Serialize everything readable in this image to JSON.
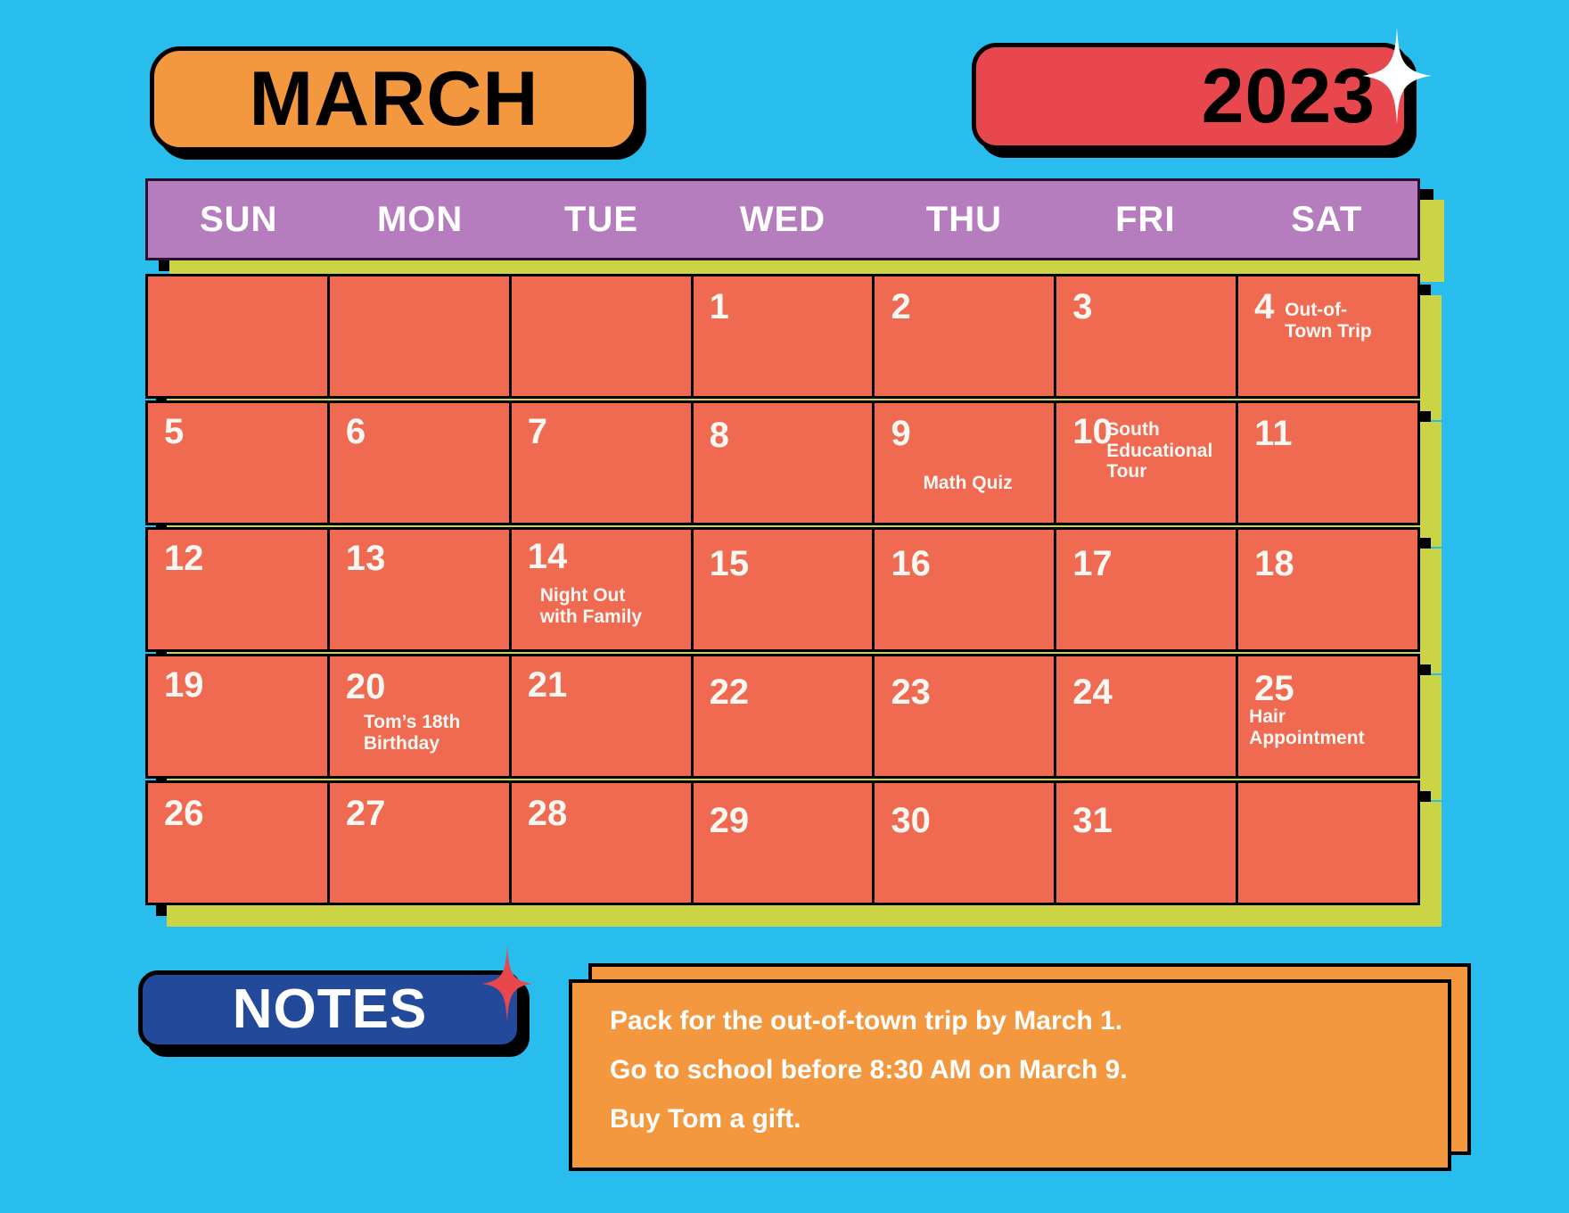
{
  "header": {
    "month": "MARCH",
    "year": "2023",
    "sparkle_icon": "four-point-star-white"
  },
  "colors": {
    "background": "#29BDEE",
    "month_badge": "#F3983E",
    "year_badge": "#E8474E",
    "day_header": "#B57DBD",
    "cell": "#EF6A51",
    "layer_lime": "#CBD444",
    "layer_shadow": "#000000",
    "notes_badge": "#23499B",
    "notes_box": "#F3983E",
    "notes_sparkle": "#E8474E",
    "text_light": "#FBF7F2"
  },
  "weekdays": [
    "SUN",
    "MON",
    "TUE",
    "WED",
    "THU",
    "FRI",
    "SAT"
  ],
  "weeks": [
    [
      {
        "day": ""
      },
      {
        "day": ""
      },
      {
        "day": ""
      },
      {
        "day": "1"
      },
      {
        "day": "2"
      },
      {
        "day": "3"
      },
      {
        "day": "4",
        "event": "Out-of-\nTown Trip"
      }
    ],
    [
      {
        "day": "5"
      },
      {
        "day": "6"
      },
      {
        "day": "7"
      },
      {
        "day": "8"
      },
      {
        "day": "9",
        "event": "Math Quiz"
      },
      {
        "day": "10",
        "event": "South\nEducational\nTour"
      },
      {
        "day": "11"
      }
    ],
    [
      {
        "day": "12"
      },
      {
        "day": "13"
      },
      {
        "day": "14",
        "event": "Night Out\nwith Family"
      },
      {
        "day": "15"
      },
      {
        "day": "16"
      },
      {
        "day": "17"
      },
      {
        "day": "18"
      }
    ],
    [
      {
        "day": "19"
      },
      {
        "day": "20",
        "event": "Tom’s 18th\nBirthday"
      },
      {
        "day": "21"
      },
      {
        "day": "22"
      },
      {
        "day": "23"
      },
      {
        "day": "24"
      },
      {
        "day": "25",
        "event": "Hair\nAppointment"
      }
    ],
    [
      {
        "day": "26"
      },
      {
        "day": "27"
      },
      {
        "day": "28"
      },
      {
        "day": "29"
      },
      {
        "day": "30"
      },
      {
        "day": "31"
      },
      {
        "day": ""
      }
    ]
  ],
  "notes": {
    "title": "NOTES",
    "sparkle_icon": "four-point-star-red",
    "lines": [
      "Pack for the out-of-town trip by March 1.",
      "Go to school before 8:30 AM on March 9.",
      "Buy Tom a gift."
    ]
  }
}
